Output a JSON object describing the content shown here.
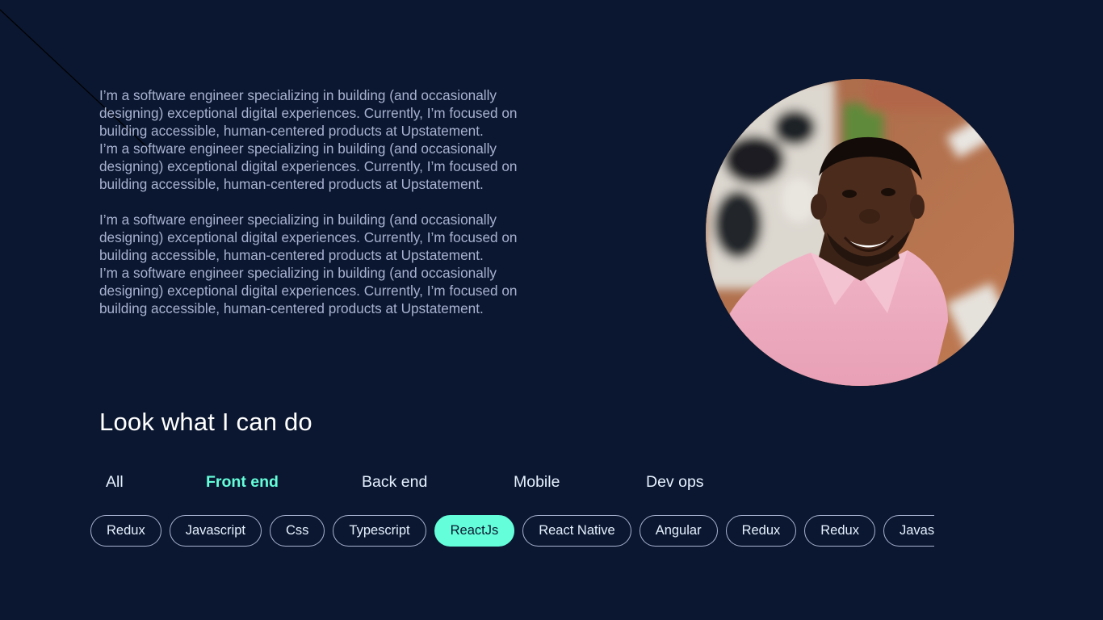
{
  "bio": {
    "paragraphs": [
      "I’m a software engineer specializing in building (and occasionally designing) exceptional digital experiences. Currently, I’m focused on building accessible, human-centered products at Upstatement.",
      "I’m a software engineer specializing in building (and occasionally designing) exceptional digital experiences. Currently, I’m focused on building accessible, human-centered products at Upstatement.",
      "I’m a software engineer specializing in building (and occasionally designing) exceptional digital experiences. Currently, I’m focused on building accessible, human-centered products at Upstatement.",
      "I’m a software engineer specializing in building (and occasionally designing) exceptional digital experiences. Currently, I’m focused on building accessible, human-centered products at Upstatement."
    ]
  },
  "skills": {
    "heading": "Look what I can do",
    "tabs": [
      {
        "label": "All",
        "active": false
      },
      {
        "label": "Front end",
        "active": true
      },
      {
        "label": "Back end",
        "active": false
      },
      {
        "label": "Mobile",
        "active": false
      },
      {
        "label": "Dev ops",
        "active": false
      }
    ],
    "chips": [
      {
        "label": "Redux",
        "active": false
      },
      {
        "label": "Javascript",
        "active": false
      },
      {
        "label": "Css",
        "active": false
      },
      {
        "label": "Typescript",
        "active": false
      },
      {
        "label": "ReactJs",
        "active": true
      },
      {
        "label": "React Native",
        "active": false
      },
      {
        "label": "Angular",
        "active": false
      },
      {
        "label": "Redux",
        "active": false
      },
      {
        "label": "Redux",
        "active": false
      },
      {
        "label": "Javascript",
        "active": false
      }
    ]
  },
  "colors": {
    "background": "#0b1730",
    "accent": "#64ffda",
    "body_text": "#a8b2d1",
    "heading_text": "#ffffff"
  }
}
